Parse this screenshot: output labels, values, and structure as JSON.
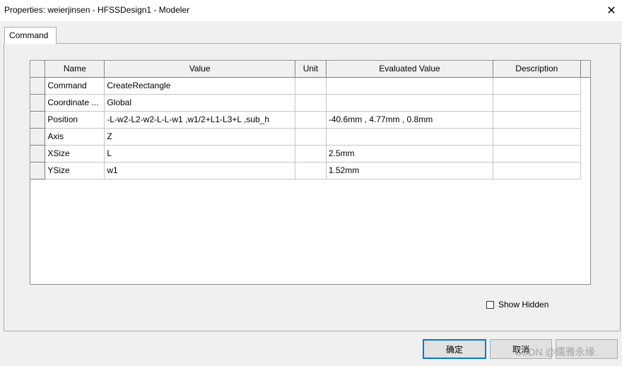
{
  "window": {
    "title": "Properties: weierjinsen - HFSSDesign1 - Modeler",
    "close_glyph": "✕"
  },
  "tabs": [
    {
      "label": "Command"
    }
  ],
  "table": {
    "columns": [
      "Name",
      "Value",
      "Unit",
      "Evaluated Value",
      "Description"
    ],
    "rows": [
      {
        "name": "Command",
        "value": "CreateRectangle",
        "unit": "",
        "evaluated": "",
        "description": ""
      },
      {
        "name": "Coordinate ...",
        "value": "Global",
        "unit": "",
        "evaluated": "",
        "description": ""
      },
      {
        "name": "Position",
        "value": "-L-w2-L2-w2-L-L-w1 ,w1/2+L1-L3+L ,sub_h",
        "unit": "",
        "evaluated": "-40.6mm , 4.77mm , 0.8mm",
        "description": ""
      },
      {
        "name": "Axis",
        "value": "Z",
        "unit": "",
        "evaluated": "",
        "description": ""
      },
      {
        "name": "XSize",
        "value": "L",
        "unit": "",
        "evaluated": "2.5mm",
        "description": ""
      },
      {
        "name": "YSize",
        "value": "w1",
        "unit": "",
        "evaluated": "1.52mm",
        "description": ""
      }
    ]
  },
  "show_hidden": {
    "label": "Show Hidden",
    "checked": false
  },
  "buttons": {
    "ok_label": "确定",
    "cancel_label": "取消"
  },
  "watermark": "CSDN @儒雅永缘"
}
